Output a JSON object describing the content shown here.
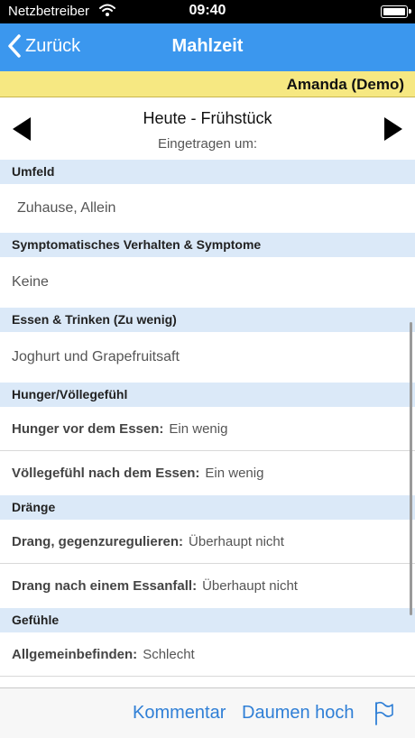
{
  "status_bar": {
    "carrier": "Netzbetreiber",
    "time": "09:40",
    "battery_level": 1.0
  },
  "nav": {
    "back_label": "Zurück",
    "title": "Mahlzeit"
  },
  "user_bar": {
    "user": "Amanda (Demo)"
  },
  "day_nav": {
    "meal_title": "Heute - Frühstück",
    "recorded_label": "Eingetragen um:"
  },
  "sections": {
    "environment": {
      "header": "Umfeld",
      "value": "Zuhause, Allein"
    },
    "symptoms": {
      "header": "Symptomatisches Verhalten & Symptome",
      "value": "Keine"
    },
    "food": {
      "header": "Essen & Trinken (Zu wenig)",
      "value": "Joghurt und Grapefruitsaft"
    },
    "hunger": {
      "header": "Hunger/Völlegefühl",
      "rows": [
        {
          "key": "Hunger vor dem Essen:",
          "value": "Ein wenig"
        },
        {
          "key": "Völlegefühl nach dem Essen:",
          "value": "Ein wenig"
        }
      ]
    },
    "urges": {
      "header": "Dränge",
      "rows": [
        {
          "key": "Drang, gegenzuregulieren:",
          "value": "Überhaupt nicht"
        },
        {
          "key": "Drang nach einem Essanfall:",
          "value": "Überhaupt nicht"
        }
      ]
    },
    "feelings": {
      "header": "Gefühle",
      "rows": [
        {
          "key": "Allgemeinbefinden:",
          "value": "Schlecht"
        }
      ]
    }
  },
  "toolbar": {
    "comment_label": "Kommentar",
    "thumbs_label": "Daumen hoch"
  },
  "colors": {
    "nav_blue": "#3b97ee",
    "user_bar_yellow": "#f6e882",
    "section_blue": "#dbe9f8",
    "link_blue": "#2f7fd6"
  },
  "icons": {
    "back": "chevron-left-icon",
    "prev": "triangle-left-icon",
    "next": "triangle-right-icon",
    "flag": "flag-icon",
    "wifi": "wifi-icon",
    "battery": "battery-icon"
  }
}
